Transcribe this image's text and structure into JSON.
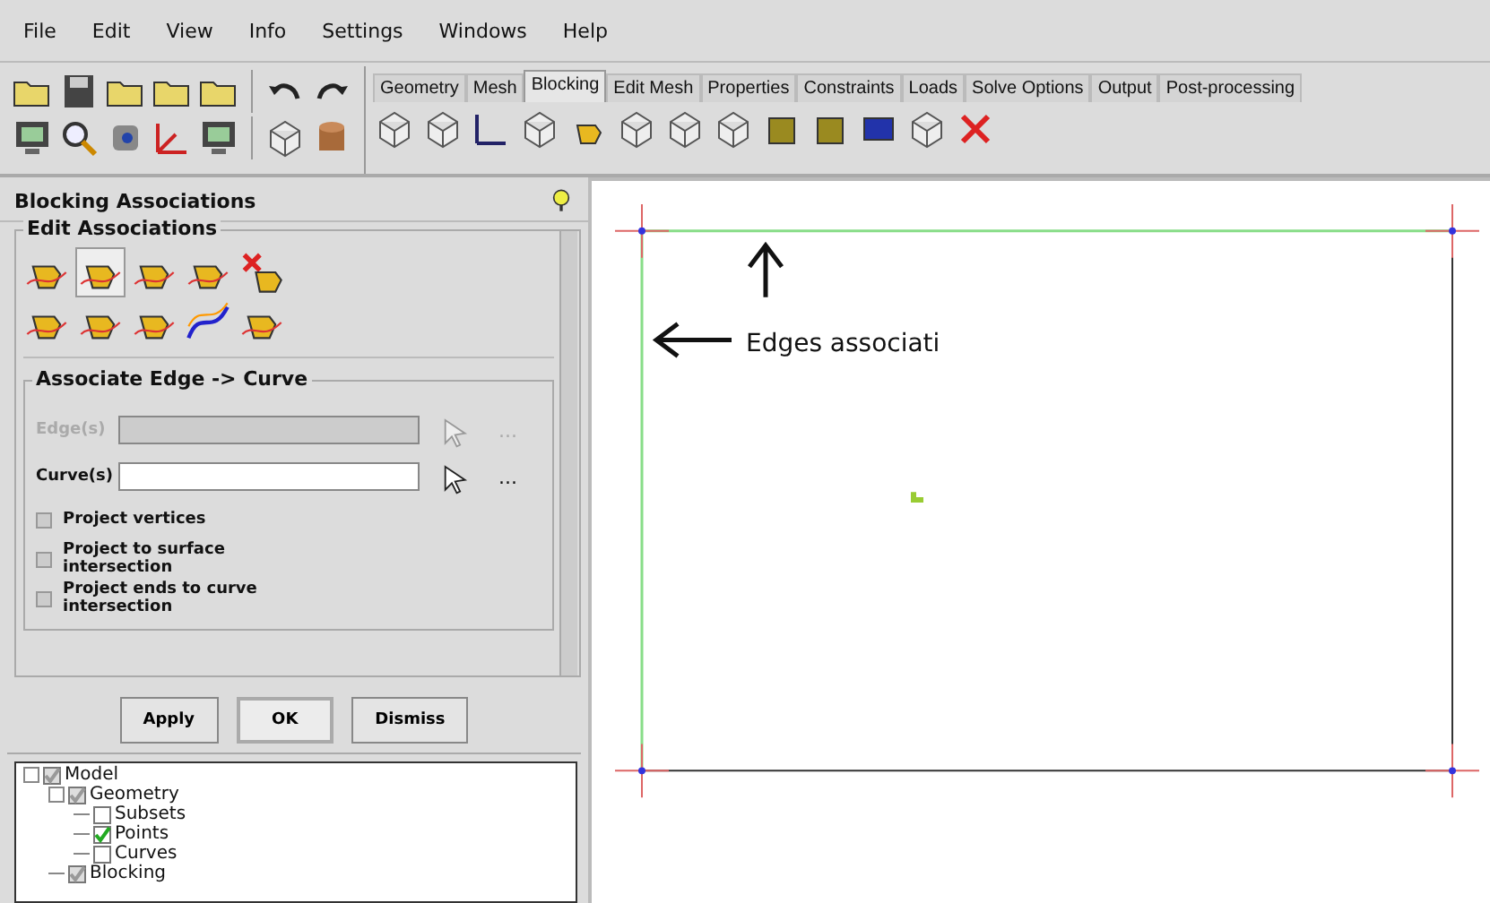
{
  "menu": [
    "File",
    "Edit",
    "View",
    "Info",
    "Settings",
    "Windows",
    "Help"
  ],
  "tabs": [
    {
      "label": "Geometry",
      "selected": false
    },
    {
      "label": "Mesh",
      "selected": false
    },
    {
      "label": "Blocking",
      "selected": true
    },
    {
      "label": "Edit Mesh",
      "selected": false
    },
    {
      "label": "Properties",
      "selected": false
    },
    {
      "label": "Constraints",
      "selected": false
    },
    {
      "label": "Loads",
      "selected": false
    },
    {
      "label": "Solve Options",
      "selected": false
    },
    {
      "label": "Output",
      "selected": false
    },
    {
      "label": "Post-processing",
      "selected": false
    }
  ],
  "panel": {
    "title": "Blocking Associations",
    "group": "Edit Associations",
    "subgroup": "Associate Edge -> Curve",
    "fields": [
      {
        "label": "Edge(s)",
        "disabled": true,
        "more": "..."
      },
      {
        "label": "Curve(s)",
        "disabled": false,
        "more": "..."
      }
    ],
    "options": [
      {
        "label": "Project vertices",
        "checked": false
      },
      {
        "label": "Project to surface intersection",
        "checked": false
      },
      {
        "label": "Project ends to curve intersection",
        "checked": false
      }
    ],
    "buttons": [
      {
        "label": "Apply",
        "selected": false
      },
      {
        "label": "OK",
        "selected": true
      },
      {
        "label": "Dismiss",
        "selected": false
      }
    ]
  },
  "tree": [
    {
      "label": "Model",
      "checked": true,
      "mixed": true,
      "children": [
        {
          "label": "Geometry",
          "checked": true,
          "mixed": true,
          "children": [
            {
              "label": "Subsets",
              "checked": false
            },
            {
              "label": "Points",
              "checked": true
            },
            {
              "label": "Curves",
              "checked": false
            }
          ]
        },
        {
          "label": "Blocking",
          "checked": true,
          "mixed": true
        }
      ]
    }
  ],
  "viewport": {
    "annotation": "Edges associati"
  }
}
